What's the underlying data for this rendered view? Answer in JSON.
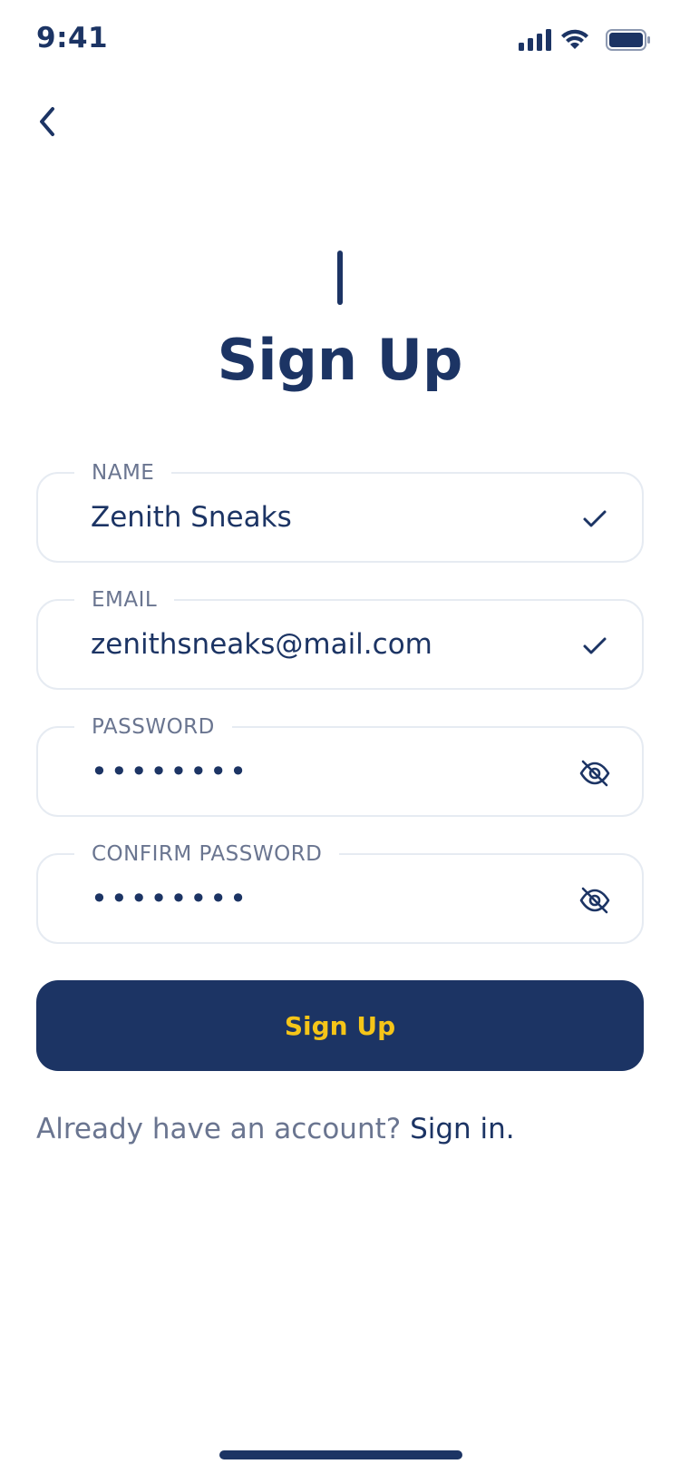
{
  "status_bar": {
    "time": "9:41",
    "icons": [
      "signal-icon",
      "wifi-icon",
      "battery-icon"
    ]
  },
  "header": {
    "back_icon": "chevron-left-icon"
  },
  "title": "Sign Up",
  "form": {
    "name": {
      "label": "NAME",
      "value": "Zenith Sneaks",
      "icon": "check-icon"
    },
    "email": {
      "label": "EMAIL",
      "value": "zenithsneaks@mail.com",
      "icon": "check-icon"
    },
    "password": {
      "label": "PASSWORD",
      "value": "••••••••",
      "icon": "eye-off-icon"
    },
    "confirm_password": {
      "label": "CONFIRM PASSWORD",
      "value": "••••••••",
      "icon": "eye-off-icon"
    }
  },
  "submit_label": "Sign Up",
  "footer": {
    "prompt": "Already have an account?",
    "link": "Sign in."
  },
  "colors": {
    "primary": "#1c3464",
    "accent": "#f5c518",
    "muted": "#6a7590",
    "border": "#e6ebf2"
  }
}
